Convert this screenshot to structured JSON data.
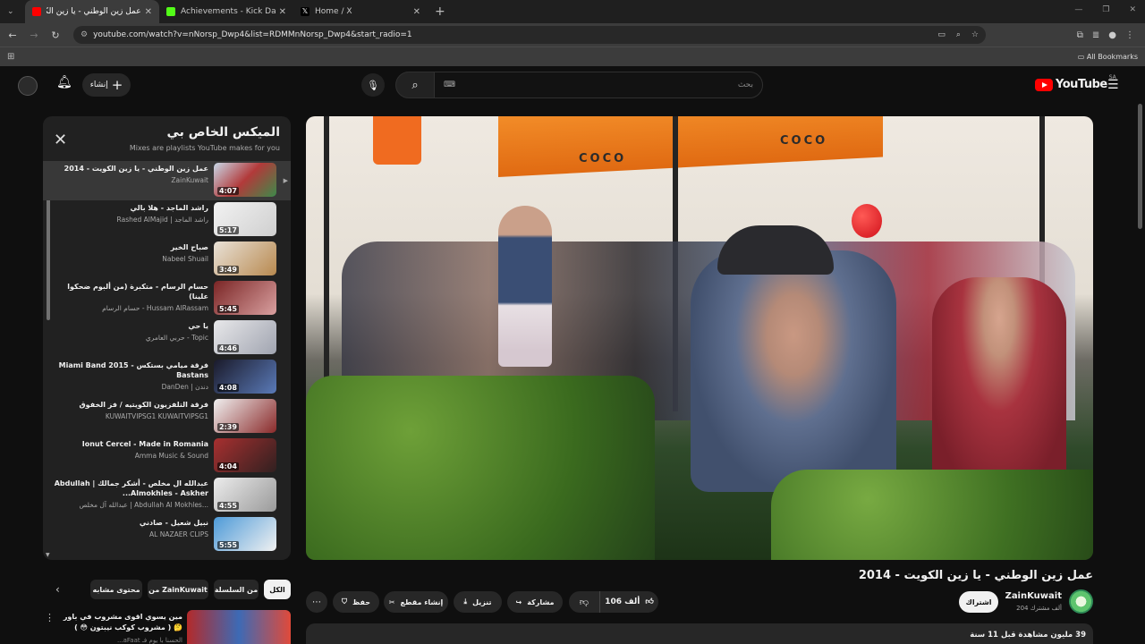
{
  "browser": {
    "tabs": [
      {
        "title": "عمل زين الوطني - يا زين الكو",
        "active": true,
        "color": "#ff0000"
      },
      {
        "title": "Achievements - Kick Dashboard",
        "active": false,
        "color": "#53fc18"
      },
      {
        "title": "Home / X",
        "active": false,
        "color": "#ffffff"
      }
    ],
    "url": "youtube.com/watch?v=nNorsp_Dwp4&list=RDMMnNorsp_Dwp4&start_radio=1",
    "bookmarks_label": "All Bookmarks"
  },
  "header": {
    "create_label": "إنشاء",
    "search_placeholder": "بحث",
    "keyboard_label": "⌨",
    "logo_text": "YouTube",
    "region": "SA",
    "accent": "#ff0000"
  },
  "playlist": {
    "title": "الميكس الخاص بي",
    "subtitle": "Mixes are playlists YouTube makes for you",
    "items": [
      {
        "title": "عمل زين الوطني - يا زين الكويت - 2014",
        "channel": "ZainKuwait",
        "duration": "4:07",
        "thumb": "linear-gradient(135deg,#c8d8e8,#b23a3a 50%,#3d8a4a)"
      },
      {
        "title": "راشد الماجد - هلا بالي",
        "channel": "Rashed AlMajid | راشد الماجد",
        "duration": "5:17",
        "thumb": "linear-gradient(135deg,#f2f2f2,#cfcfcf)"
      },
      {
        "title": "صباح الخير",
        "channel": "Nabeel Shuail",
        "duration": "3:49",
        "thumb": "linear-gradient(135deg,#e9e2d8,#b8894f)"
      },
      {
        "title": "حسام الرسام - متكبرة (من ألبوم ضحكوا علينا)",
        "channel": "حسام الرسام - Hussam AlRassam",
        "duration": "5:45",
        "thumb": "linear-gradient(135deg,#7a2525,#d9a0a0)"
      },
      {
        "title": "يا حي",
        "channel": "حربي العامري - Topic",
        "duration": "4:46",
        "thumb": "linear-gradient(135deg,#e8e8ea,#a0a4b0)"
      },
      {
        "title": "فرقة ميامي بستكس Miami Band 2015 - Bastans",
        "channel": "DanDen | دندن",
        "duration": "4:08",
        "thumb": "linear-gradient(135deg,#1a1a2a,#5a7ab8)"
      },
      {
        "title": "فرقة التلفزيون الكويتيه / فز الخفوق",
        "channel": "KUWAITVIPSG1 KUWAITVIPSG1",
        "duration": "2:39",
        "thumb": "linear-gradient(135deg,#f0f0f0,#8a2a2a)"
      },
      {
        "title": "Ionut Cercel - Made in Romania",
        "channel": "Amma Music & Sound",
        "duration": "4:04",
        "thumb": "linear-gradient(135deg,#a83030,#302020)"
      },
      {
        "title": "عبدالله ال مخلص - أشكر جمالك | Abdullah Almokhles - Askher...",
        "channel": "عبدالله آل مخلص | Abdullah Al Mokhles...",
        "duration": "4:55",
        "thumb": "linear-gradient(135deg,#ececec,#9a9a9a)"
      },
      {
        "title": "نبيل شعيل - صادني",
        "channel": "AL NAZAER CLIPS",
        "duration": "5:55",
        "thumb": "linear-gradient(135deg,#4d9ad8,#f1f1f1)"
      }
    ]
  },
  "chips": {
    "all": "الكل",
    "series": "من السلسلة",
    "from_channel": "من ZainKuwait",
    "related": "محتوى مشابه"
  },
  "side_rec": {
    "title": "مين يسوي اقوى مشروب في باور 🤔 ( مشروب كوكب نيبتون 😳 )",
    "meta": "...aFaat الحسنا با يوم فـ"
  },
  "video": {
    "title": "عمل زين الوطني - يا زين الكويت - 2014",
    "channel": "ZainKuwait",
    "subscribers": "204 ألف مشترك",
    "subscribe_label": "اشتراك",
    "likes": "106 ألف",
    "share_label": "مشاركة",
    "download_label": "تنزيل",
    "clip_label": "إنشاء مقطع",
    "save_label": "حفظ",
    "views_meta": "39 مليون مشاهدة  قبل 11 سنة",
    "sign_text": "COCO"
  }
}
